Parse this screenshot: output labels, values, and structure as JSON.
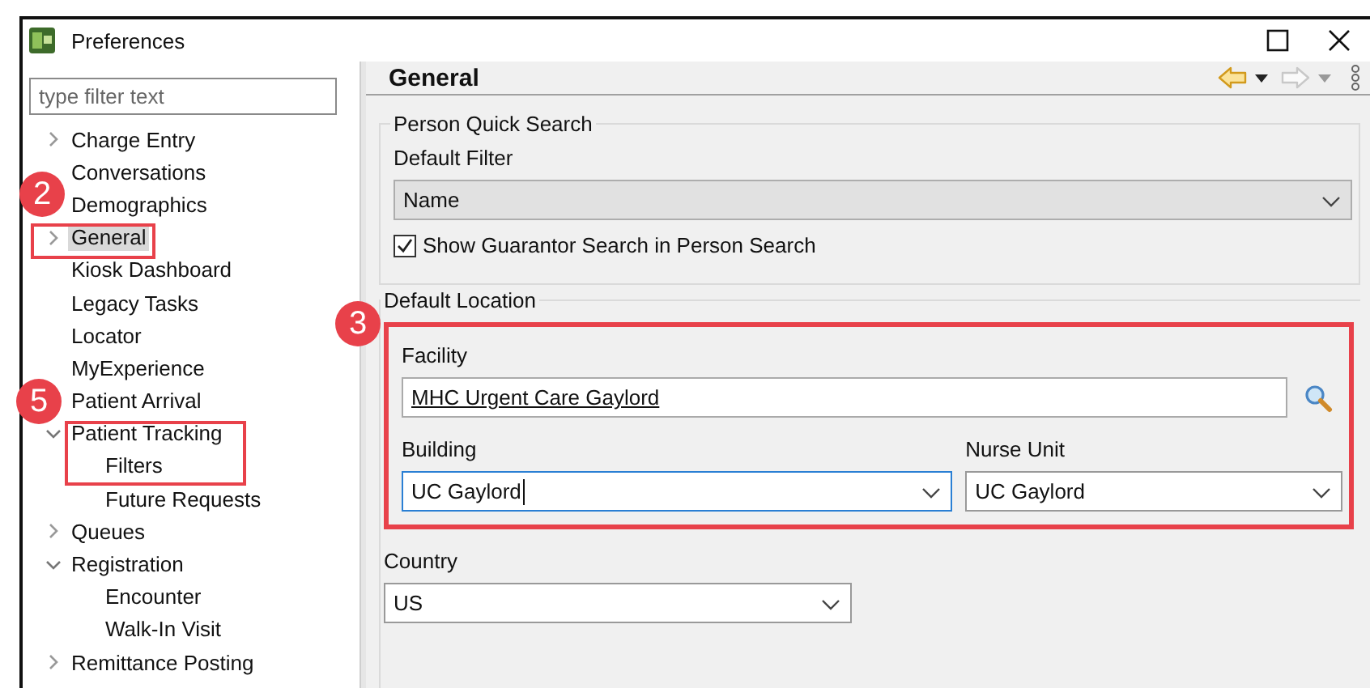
{
  "window": {
    "title": "Preferences"
  },
  "filter": {
    "placeholder": "type filter text"
  },
  "tree": [
    {
      "label": "Charge Entry",
      "expanded": false,
      "selected": false
    },
    {
      "label": "Conversations",
      "selected": false
    },
    {
      "label": "Demographics",
      "selected": false
    },
    {
      "label": "General",
      "expanded": false,
      "selected": true
    },
    {
      "label": "Kiosk Dashboard",
      "selected": false
    },
    {
      "label": "Legacy Tasks",
      "selected": false
    },
    {
      "label": "Locator",
      "selected": false
    },
    {
      "label": "MyExperience",
      "selected": false
    },
    {
      "label": "Patient Arrival",
      "selected": false
    },
    {
      "label": "Patient Tracking",
      "expanded": true,
      "selected": false,
      "children": [
        {
          "label": "Filters",
          "selected": false
        },
        {
          "label": "Future Requests",
          "selected": false
        }
      ]
    },
    {
      "label": "Queues",
      "expanded": false,
      "selected": false
    },
    {
      "label": "Registration",
      "expanded": true,
      "selected": false,
      "children": [
        {
          "label": "Encounter",
          "selected": false
        },
        {
          "label": "Walk-In Visit",
          "selected": false
        }
      ]
    },
    {
      "label": "Remittance Posting",
      "expanded": false,
      "selected": false
    }
  ],
  "page": {
    "title": "General",
    "back_disabled": false,
    "forward_disabled": true
  },
  "person_quick_search": {
    "legend": "Person Quick Search",
    "filter_label": "Default Filter",
    "filter_value": "Name",
    "guarantor": {
      "label": "Show Guarantor Search in Person Search",
      "checked": true
    }
  },
  "default_location": {
    "legend": "Default Location",
    "facility": {
      "label": "Facility",
      "value": "MHC Urgent Care Gaylord"
    },
    "building": {
      "label": "Building",
      "value": "UC Gaylord",
      "focused": true
    },
    "nurse_unit": {
      "label": "Nurse Unit",
      "value": "UC Gaylord",
      "focused": false
    },
    "country": {
      "label": "Country",
      "value": "US",
      "focused": false
    }
  },
  "callouts": [
    {
      "label": "2"
    },
    {
      "label": "3"
    },
    {
      "label": "5"
    }
  ]
}
